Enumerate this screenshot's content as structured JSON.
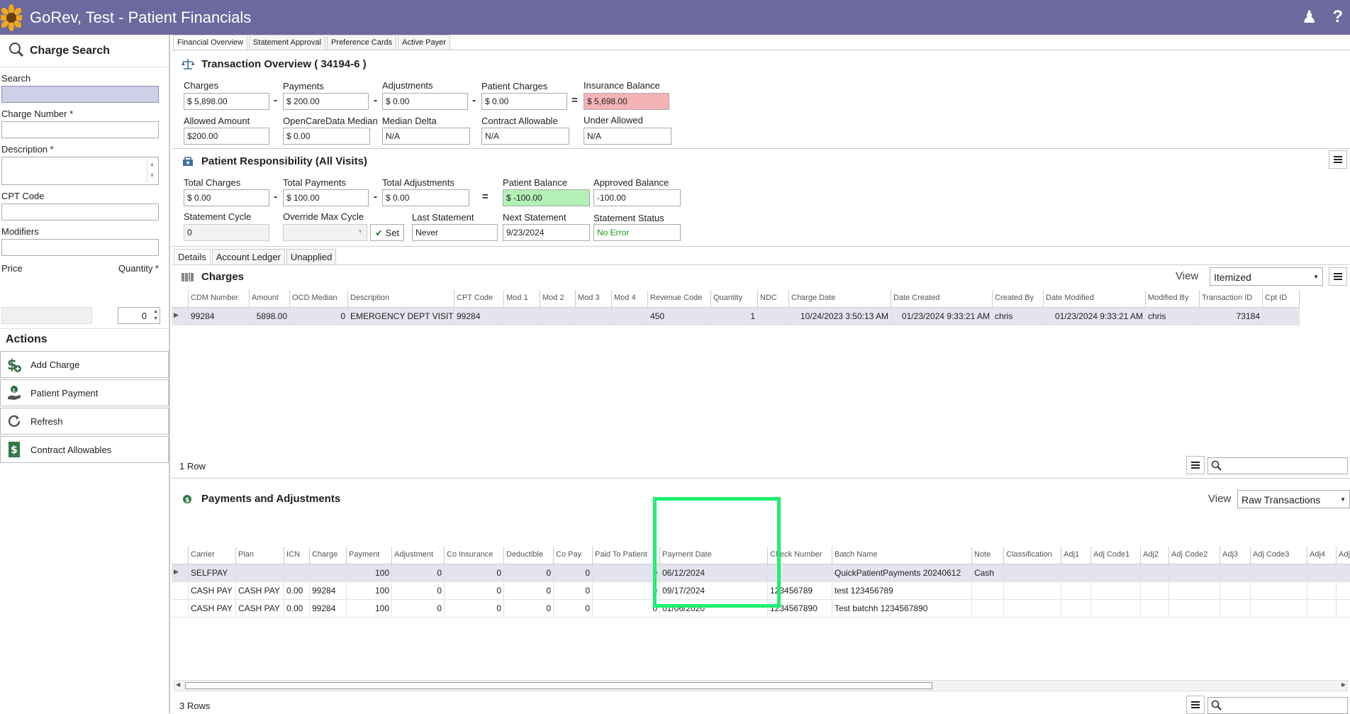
{
  "window": {
    "title": "GoRev, Test - Patient Financials"
  },
  "left_panel": {
    "title": "Charge Search",
    "search_label": "Search",
    "charge_number_label": "Charge Number *",
    "description_label": "Description *",
    "cpt_label": "CPT Code",
    "modifiers_label": "Modifiers",
    "price_label": "Price",
    "quantity_label": "Quantity *",
    "quantity_value": "0",
    "actions_title": "Actions",
    "actions": [
      "Add Charge",
      "Patient Payment",
      "Refresh",
      "Contract Allowables"
    ]
  },
  "tabs": [
    "Financial Overview",
    "Statement Approval",
    "Preference Cards",
    "Active Payer"
  ],
  "transaction": {
    "title": "Transaction Overview ( 34194-6 )",
    "charges_label": "Charges",
    "charges": "$ 5,898.00",
    "payments_label": "Payments",
    "payments": "$ 200.00",
    "adjustments_label": "Adjustments",
    "adjustments": "$ 0.00",
    "patient_charges_label": "Patient Charges",
    "patient_charges": "$ 0.00",
    "insurance_balance_label": "Insurance Balance",
    "insurance_balance": "$ 5,698.00",
    "allowed_label": "Allowed Amount",
    "allowed": "$200.00",
    "ocd_label": "OpenCareData Median",
    "ocd": "$ 0.00",
    "median_delta_label": "Median Delta",
    "median_delta": "N/A",
    "contract_label": "Contract Allowable",
    "contract": "N/A",
    "under_label": "Under Allowed",
    "under": "N/A"
  },
  "responsibility": {
    "title": "Patient Responsibility (All Visits)",
    "total_charges_label": "Total Charges",
    "total_charges": "$ 0.00",
    "total_payments_label": "Total Payments",
    "total_payments": "$ 100.00",
    "total_adjustments_label": "Total Adjustments",
    "total_adjustments": "$ 0.00",
    "patient_balance_label": "Patient Balance",
    "patient_balance": "$ -100.00",
    "approved_label": "Approved Balance",
    "approved": "-100.00",
    "cycle_label": "Statement Cycle",
    "cycle": "0",
    "override_label": "Override Max Cycle",
    "set_label": "Set",
    "last_label": "Last Statement",
    "last": "Never",
    "next_label": "Next Statement",
    "next": "9/23/2024",
    "status_label": "Statement Status",
    "status": "No Error"
  },
  "subtabs": [
    "Details",
    "Account Ledger",
    "Unapplied"
  ],
  "charges": {
    "title": "Charges",
    "view_label": "View",
    "view_value": "Itemized",
    "columns": [
      "CDM Number",
      "Amount",
      "OCD Median",
      "Description",
      "CPT Code",
      "Mod 1",
      "Mod 2",
      "Mod 3",
      "Mod 4",
      "Revenue Code",
      "Quantity",
      "NDC",
      "Charge Date",
      "Date Created",
      "Created By",
      "Date Modified",
      "Modified By",
      "Transaction ID",
      "Cpt ID"
    ],
    "rows": [
      [
        "99284",
        "5898.00",
        "0",
        "EMERGENCY DEPT VISIT",
        "99284",
        "",
        "",
        "",
        "",
        "450",
        "1",
        "",
        "10/24/2023 3:50:13 AM",
        "01/23/2024 9:33:21 AM",
        "chris",
        "01/23/2024 9:33:21 AM",
        "chris",
        "73184",
        ""
      ]
    ],
    "row_count": "1 Row"
  },
  "payments": {
    "title": "Payments and Adjustments",
    "view_label": "View",
    "view_value": "Raw Transactions",
    "columns": [
      "Carrier",
      "Plan",
      "ICN",
      "Charge",
      "Payment",
      "Adjustment",
      "Co Insurance",
      "Deductible",
      "Co Pay",
      "Paid To Patient",
      "Payment Date",
      "Check Number",
      "Batch Name",
      "Note",
      "Classification",
      "Adj1",
      "Adj Code1",
      "Adj2",
      "Adj Code2",
      "Adj3",
      "Adj Code3",
      "Adj4",
      "Adj C"
    ],
    "rows": [
      [
        "SELFPAY",
        "",
        "",
        "",
        "100",
        "0",
        "0",
        "0",
        "0",
        "0",
        "06/12/2024",
        "",
        "QuickPatientPayments 20240612",
        "Cash",
        "",
        "",
        "",
        "",
        "",
        "",
        "",
        "",
        ""
      ],
      [
        "CASH PAY",
        "CASH PAY",
        "0.00",
        "99284",
        "100",
        "0",
        "0",
        "0",
        "0",
        "0",
        "09/17/2024",
        "123456789",
        "test 123456789",
        "",
        "",
        "",
        "",
        "",
        "",
        "",
        "",
        "",
        ""
      ],
      [
        "CASH PAY",
        "CASH PAY",
        "0.00",
        "99284",
        "100",
        "0",
        "0",
        "0",
        "0",
        "0",
        "01/06/2020",
        "1234567890",
        "Test batchh 1234567890",
        "",
        "",
        "",
        "",
        "",
        "",
        "",
        "",
        "",
        ""
      ]
    ],
    "row_count": "3 Rows"
  },
  "colors": {
    "titlebar": "#6b699d",
    "highlight": "#1ef070",
    "insurance_bg": "#f4b4b6",
    "balance_bg": "#b3f0b5"
  }
}
